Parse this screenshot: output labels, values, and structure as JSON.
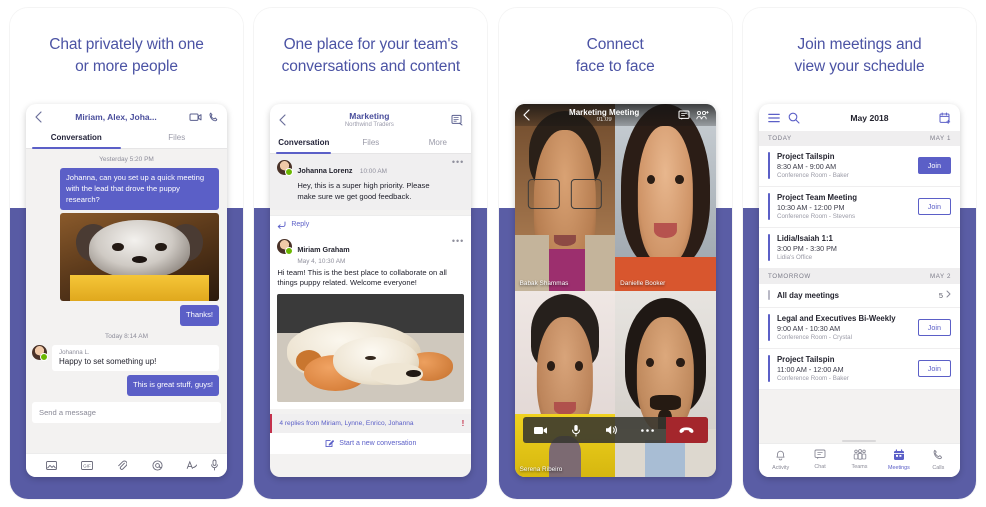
{
  "cards": [
    {
      "headline": [
        "Chat privately with one",
        "or more people"
      ],
      "phone": {
        "header_title": "Miriam, Alex, Joha...",
        "icons": [
          "back-chevron-icon",
          "video-call-icon",
          "phone-call-icon"
        ],
        "tabs": [
          {
            "label": "Conversation",
            "active": true
          },
          {
            "label": "Files",
            "active": false
          }
        ],
        "daystamp_1": "Yesterday 5:20 PM",
        "outgoing_1": "Johanna, can you set up a quick meeting with the lead that drove the puppy research?",
        "outgoing_2": "Thanks!",
        "daystamp_2": "Today 8:14 AM",
        "incoming_name": "Johanna L.",
        "incoming_text": "Happy to set something up!",
        "outgoing_3": "This is great stuff, guys!",
        "composer_placeholder": "Send a message",
        "tools": [
          "image-icon",
          "gif-icon",
          "attachment-icon",
          "mention-icon",
          "format-icon",
          "microphone-icon"
        ]
      }
    },
    {
      "headline": [
        "One place for your team's",
        "conversations and content"
      ],
      "phone": {
        "header_title": "Marketing",
        "header_sub": "Northwind Traders",
        "icons": [
          "back-chevron-icon",
          "compose-icon"
        ],
        "tabs": [
          {
            "label": "Conversation",
            "active": true
          },
          {
            "label": "Files",
            "active": false
          },
          {
            "label": "More",
            "active": false
          }
        ],
        "post_1": {
          "name": "Johanna Lorenz",
          "time": "10:00 AM",
          "text": "Hey, this is a super high priority. Please make sure we get good feedback.",
          "reply_label": "Reply"
        },
        "post_2": {
          "name": "Miriam Graham",
          "time": "May 4, 10:30 AM",
          "text": "Hi team! This is the best place to collaborate on all things puppy related. Welcome everyone!"
        },
        "replies_text": "4 replies from Miriam, Lynne, Enrico, Johanna",
        "replies_flag": "!",
        "new_conversation": "Start a new conversation"
      }
    },
    {
      "headline": [
        "Connect",
        "face to face"
      ],
      "phone": {
        "call_title": "Marketing Meeting",
        "call_timer": "01:09",
        "icons": [
          "back-chevron-icon",
          "chat-icon",
          "participants-icon"
        ],
        "participants": [
          "Babak Shammas",
          "Danielle Booker",
          "Serena Ribeiro",
          ""
        ],
        "controls": [
          "video-icon",
          "microphone-icon",
          "speaker-icon",
          "more-icon",
          "hangup-icon"
        ]
      }
    },
    {
      "headline": [
        "Join meetings and",
        "view your schedule"
      ],
      "phone": {
        "header_title": "May 2018",
        "icons": [
          "hamburger-icon",
          "search-icon",
          "add-event-icon"
        ],
        "sections": [
          {
            "label": "TODAY",
            "date": "MAY 1",
            "events": [
              {
                "title": "Project Tailspin",
                "time": "8:30 AM - 9:00 AM",
                "location": "Conference Room - Baker",
                "join": "Join",
                "join_style": "solid"
              },
              {
                "title": "Project Team Meeting",
                "time": "10:30 AM - 12:00 PM",
                "location": "Conference Room - Stevens",
                "join": "Join",
                "join_style": "outline"
              },
              {
                "title": "Lidia/Isaiah 1:1",
                "time": "3:00 PM - 3:30 PM",
                "location": "Lidia's Office",
                "join": "",
                "join_style": "none"
              }
            ]
          },
          {
            "label": "TOMORROW",
            "date": "MAY 2",
            "events": [
              {
                "title": "All day meetings",
                "time": "",
                "location": "",
                "count": "5",
                "join": "",
                "join_style": "none"
              },
              {
                "title": "Legal and Executives Bi-Weekly",
                "time": "9:00 AM - 10:30 AM",
                "location": "Conference Room - Crystal",
                "join": "Join",
                "join_style": "outline"
              },
              {
                "title": "Project Tailspin",
                "time": "11:00 AM - 12:00 AM",
                "location": "Conference Room - Baker",
                "join": "Join",
                "join_style": "outline"
              }
            ]
          }
        ],
        "nav": [
          {
            "label": "Activity",
            "icon": "bell-icon",
            "active": false
          },
          {
            "label": "Chat",
            "icon": "chat-icon",
            "active": false
          },
          {
            "label": "Teams",
            "icon": "teams-icon",
            "active": false
          },
          {
            "label": "Meetings",
            "icon": "calendar-icon",
            "active": true
          },
          {
            "label": "Calls",
            "icon": "phone-icon",
            "active": false
          }
        ]
      }
    }
  ],
  "colors": {
    "brand_purple": "#5b5fc7",
    "card_purple": "#5a5da5",
    "headline": "#4b53a4",
    "danger": "#c4314b",
    "hangup": "#a4262c"
  }
}
